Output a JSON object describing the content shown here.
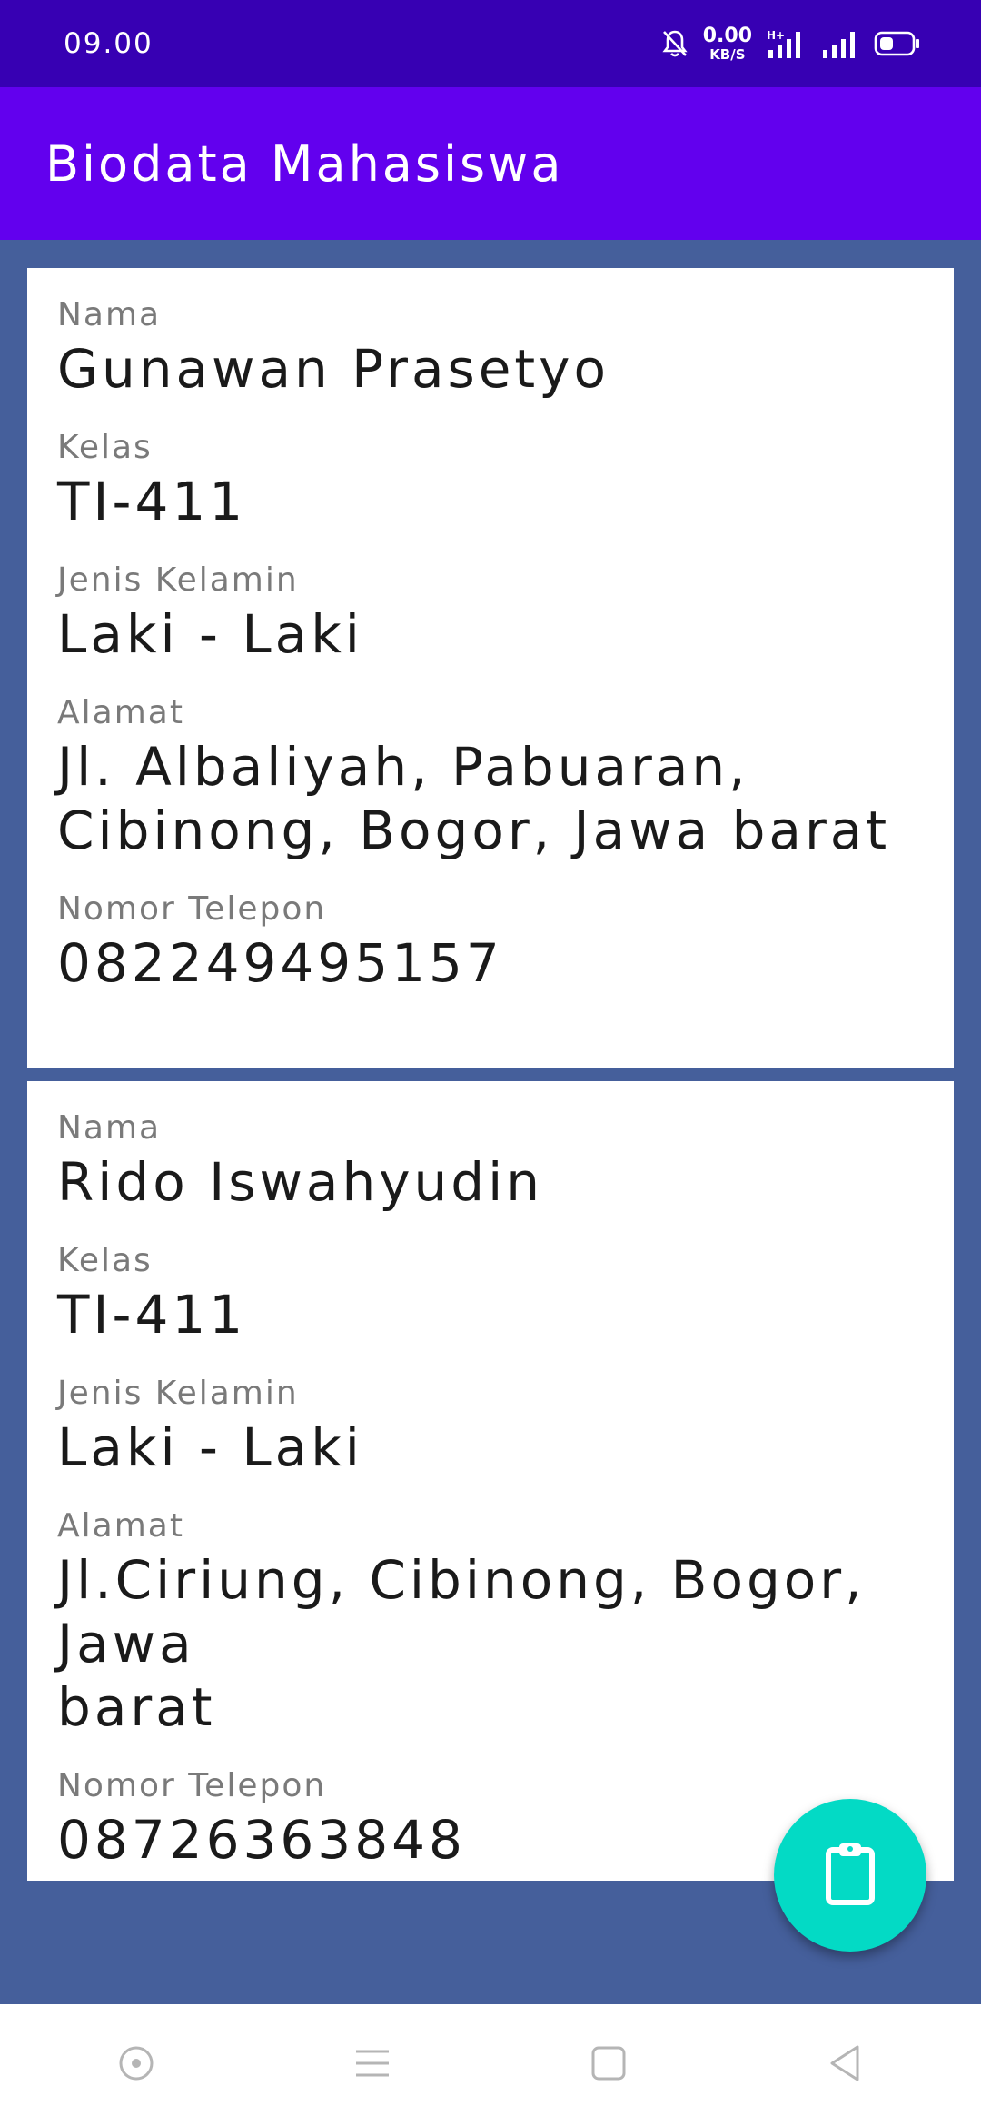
{
  "status_bar": {
    "time": "09.00",
    "net_speed_value": "0.00",
    "net_speed_unit": "KB/S",
    "icons": [
      "bell-muted-icon",
      "hplus-signal-icon",
      "signal-icon",
      "battery-icon"
    ]
  },
  "app_bar": {
    "title": "Biodata Mahasiswa"
  },
  "students": [
    {
      "name_label": "Nama",
      "name": "Gunawan Prasetyo",
      "class_label": "Kelas",
      "class": "TI-411",
      "gender_label": "Jenis Kelamin",
      "gender": "Laki - Laki",
      "address_label": "Alamat",
      "address_line1": "Jl. Albaliyah, Pabuaran,",
      "address_line2": "Cibinong, Bogor, Jawa barat",
      "phone_label": "Nomor Telepon",
      "phone": "082249495157"
    },
    {
      "name_label": "Nama",
      "name": "Rido Iswahyudin",
      "class_label": "Kelas",
      "class": "TI-411",
      "gender_label": "Jenis Kelamin",
      "gender": "Laki - Laki",
      "address_label": "Alamat",
      "address_line1": "Jl.Ciriung, Cibinong, Bogor, Jawa",
      "address_line2": "barat",
      "phone_label": "Nomor Telepon",
      "phone": "08726363848"
    }
  ],
  "fab": {
    "icon": "clipboard-icon",
    "color": "#03dac5"
  },
  "nav_bar": {
    "buttons": [
      "assistant-icon",
      "menu-icon",
      "home-square-icon",
      "back-triangle-icon"
    ]
  },
  "colors": {
    "status_bar": "#3700b3",
    "app_bar": "#6200ee",
    "background": "#455f9b",
    "card": "#ffffff"
  }
}
